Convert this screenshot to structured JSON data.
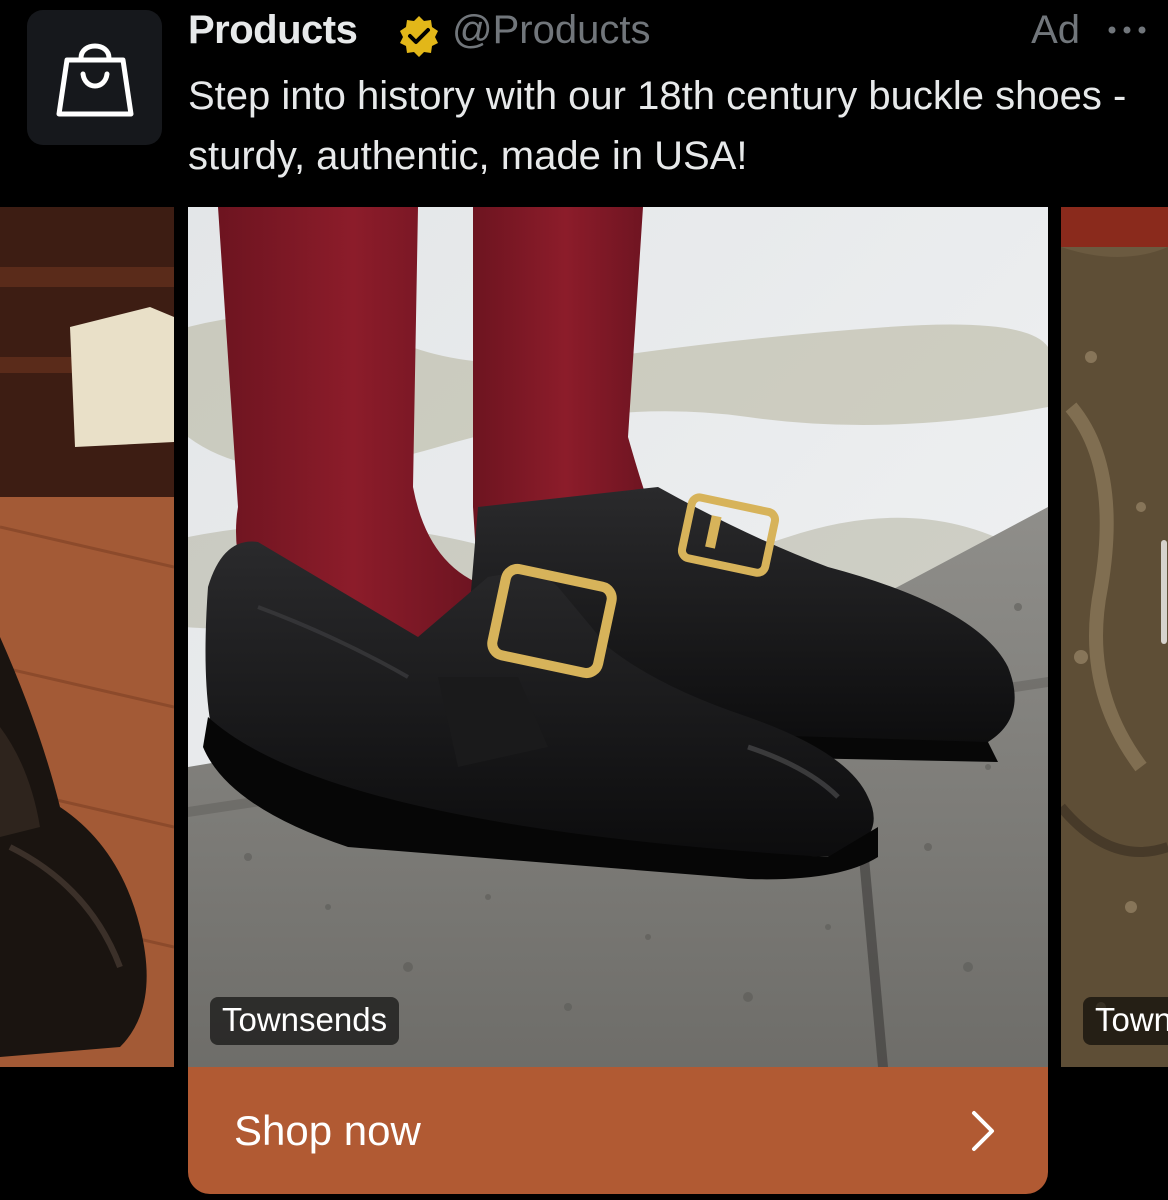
{
  "account": {
    "name": "Products",
    "handle": "@Products",
    "ad_label": "Ad",
    "verified_color": "#e2b719",
    "avatar_icon": "shopping-bag-icon"
  },
  "post": {
    "text": "Step into history with our 18th century buckle shoes - sturdy, authentic, made in USA!"
  },
  "carousel": {
    "main_source": "Townsends",
    "next_source": "Town"
  },
  "cta": {
    "label": "Shop now",
    "color": "#b15a33",
    "icon": "chevron-right-icon"
  }
}
